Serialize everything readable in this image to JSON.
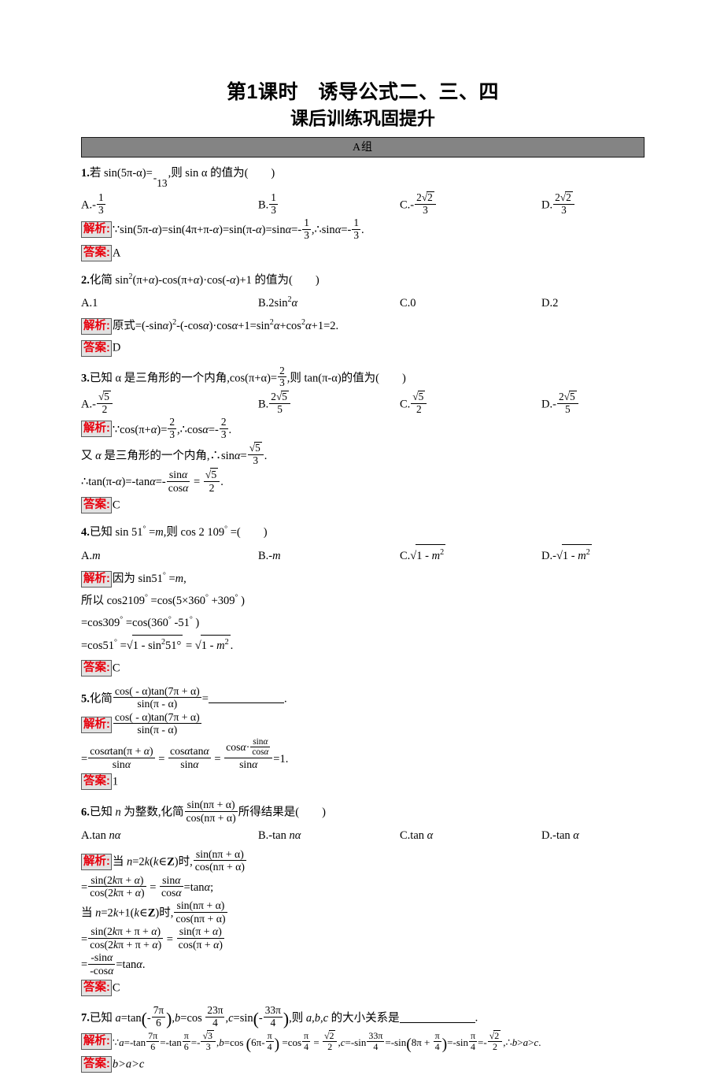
{
  "document": {
    "title_main": "第1课时　诱导公式二、三、四",
    "title_sub": "课后训练巩固提升",
    "group_band": "A组",
    "tag_analysis": "解析:",
    "tag_answer": "答案:"
  },
  "questions": [
    {
      "number": "1.",
      "stem_prefix": "若 sin(5π-α)=",
      "stem_frac": {
        "num": "1",
        "den": "3",
        "sign": "-"
      },
      "stem_suffix": ",则 sin α 的值为(",
      "stem_close": ")",
      "options": [
        {
          "label": "A.",
          "sign": "-",
          "type": "frac",
          "num": "1",
          "den": "3"
        },
        {
          "label": "B.",
          "sign": "",
          "type": "frac",
          "num": "1",
          "den": "3"
        },
        {
          "label": "C.",
          "sign": "-",
          "type": "frac",
          "num": "2√2",
          "den": "3"
        },
        {
          "label": "D.",
          "sign": "",
          "type": "frac",
          "num": "2√2",
          "den": "3"
        }
      ],
      "analysis": "∵sin(5π-α)=sin(4π+π-α)=sin(π-α)=sinα=-1/3,∴sinα=-1/3.",
      "answer": "A"
    },
    {
      "number": "2.",
      "stem": "化简 sin²(π+α)-cos(π+α)·cos(-α)+1 的值为(     )",
      "options": [
        {
          "label": "A.",
          "text": "1"
        },
        {
          "label": "B.",
          "text": "2sin²α"
        },
        {
          "label": "C.",
          "text": "0"
        },
        {
          "label": "D.",
          "text": "2"
        }
      ],
      "analysis": "原式=(-sinα)²-(-cosα)·cosα+1=sin²α+cos²α+1=2.",
      "answer": "D"
    },
    {
      "number": "3.",
      "stem_prefix": "已知 α 是三角形的一个内角,cos(π+α)=",
      "stem_frac": {
        "num": "2",
        "den": "3"
      },
      "stem_suffix": ",则 tan(π-α)的值为(",
      "stem_close": ")",
      "options": [
        {
          "label": "A.",
          "sign": "-",
          "num": "√5",
          "den": "2"
        },
        {
          "label": "B.",
          "sign": "",
          "num": "2√5",
          "den": "5"
        },
        {
          "label": "C.",
          "sign": "",
          "num": "√5",
          "den": "2"
        },
        {
          "label": "D.",
          "sign": "-",
          "num": "2√5",
          "den": "5"
        }
      ],
      "analysis_line1": "∵cos(π+α)=2/3,∴cosα=-2/3.",
      "analysis_line2": "又 α 是三角形的一个内角,∴sinα=√5/3.",
      "analysis_line3": "∴tan(π-α)=-tanα=-sinα/cosα = √5/2.",
      "answer": "C"
    },
    {
      "number": "4.",
      "stem": "已知 sin 51° =m,则 cos 2 109° =(     )",
      "options": [
        {
          "label": "A.",
          "text": "m"
        },
        {
          "label": "B.",
          "text": "-m"
        },
        {
          "label": "C.",
          "text": "√(1 - m²)"
        },
        {
          "label": "D.",
          "text": "-√(1 - m²)"
        }
      ],
      "analysis_lines": [
        "因为 sin51° =m,",
        "所以 cos2109° =cos(5×360° +309° )",
        "=cos309° =cos(360° -51° )",
        "=cos51° =√(1 - sin²51°) = √(1 - m²)."
      ],
      "answer": "C"
    },
    {
      "number": "5.",
      "stem_prefix": "化简",
      "stem_frac_num": "cos( - α)tan(7π + α)",
      "stem_frac_den": "sin(π - α)",
      "stem_eq": "=",
      "stem_blank": "",
      "stem_period": ".",
      "analysis_frac_num": "cos( - α)tan(7π + α)",
      "analysis_frac_den": "sin(π - α)",
      "analysis_line2_parts": [
        {
          "num": "cosαtan(π + α)",
          "den": "sinα"
        },
        {
          "num": "cosαtanα",
          "den": "sinα"
        },
        {
          "num": "cosα· sinα/cosα",
          "den": "sinα"
        }
      ],
      "analysis_result": "=1.",
      "answer": "1"
    },
    {
      "number": "6.",
      "stem_prefix": "已知 n 为整数,化简",
      "stem_frac_num": "sin(nπ + α)",
      "stem_frac_den": "cos(nπ + α)",
      "stem_suffix": "所得结果是(",
      "stem_close": ")",
      "options": [
        {
          "label": "A.",
          "text": "tan nα"
        },
        {
          "label": "B.",
          "text": "-tan nα"
        },
        {
          "label": "C.",
          "text": "tan α"
        },
        {
          "label": "D.",
          "text": "-tan α"
        }
      ],
      "analysis_a_prefix": "当 n=2k(k∈Z)时,",
      "analysis_a_frac_num": "sin(nπ + α)",
      "analysis_a_frac_den": "cos(nπ + α)",
      "analysis_a_line2": "=sin(2kπ + α)/cos(2kπ + α) = sinα/cosα=tanα;",
      "analysis_b_prefix": "当 n=2k+1(k∈Z)时,",
      "analysis_b_frac_num": "sin(nπ + α)",
      "analysis_b_frac_den": "cos(nπ + α)",
      "analysis_b_line2": "=sin(2kπ + π + α)/cos(2kπ + π + α) = sin(π + α)/cos(π + α)",
      "analysis_b_line3": "=-sinα/-cosα=tanα.",
      "answer": "C"
    },
    {
      "number": "7.",
      "stem_prefix": "已知 a=tan",
      "stem_paren1": "- 7π/6",
      "stem_mid1": ",b=cos",
      "stem_frac2": "23π/4",
      "stem_mid2": ",c=sin",
      "stem_paren2": "- 33π/4",
      "stem_suffix": ",则 a,b,c 的大小关系是",
      "stem_period": ".",
      "analysis": "∵a=-tan7π/6=-tanπ/6=-√3/3,b=cos(6π-π/4) =cosπ/4 = √2/2,c=-sin33π/4=-sin(8π + π/4)=-sinπ/4=-√2/2,∴b>a>c.",
      "answer": "b>a>c"
    }
  ]
}
